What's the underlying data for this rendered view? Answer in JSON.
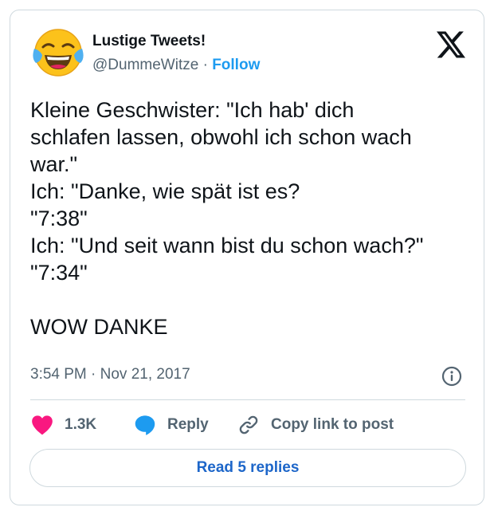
{
  "author": {
    "display_name": "Lustige Tweets!",
    "handle": "@DummeWitze",
    "separator": "·",
    "follow_label": "Follow",
    "avatar_icon": "face-with-tears-of-joy-emoji"
  },
  "tweet": {
    "lines": [
      "Kleine Geschwister: \"Ich hab' dich",
      "schlafen lassen, obwohl ich schon wach",
      "war.\"",
      "Ich: \"Danke, wie spät ist es?",
      "\"7:38\"",
      "Ich: \"Und seit wann bist du schon wach?\"",
      "\"7:34\"",
      "",
      "WOW DANKE"
    ],
    "timestamp": "3:54 PM · Nov 21, 2017"
  },
  "actions": {
    "like_count": "1.3K",
    "reply_label": "Reply",
    "copy_label": "Copy link to post",
    "read_replies_label": "Read 5 replies"
  },
  "colors": {
    "accent": "#1d9bf0",
    "like": "#f91880",
    "reply_icon": "#1d9bf0",
    "text": "#0f1419",
    "secondary": "#536471",
    "border": "#cfd9de"
  }
}
